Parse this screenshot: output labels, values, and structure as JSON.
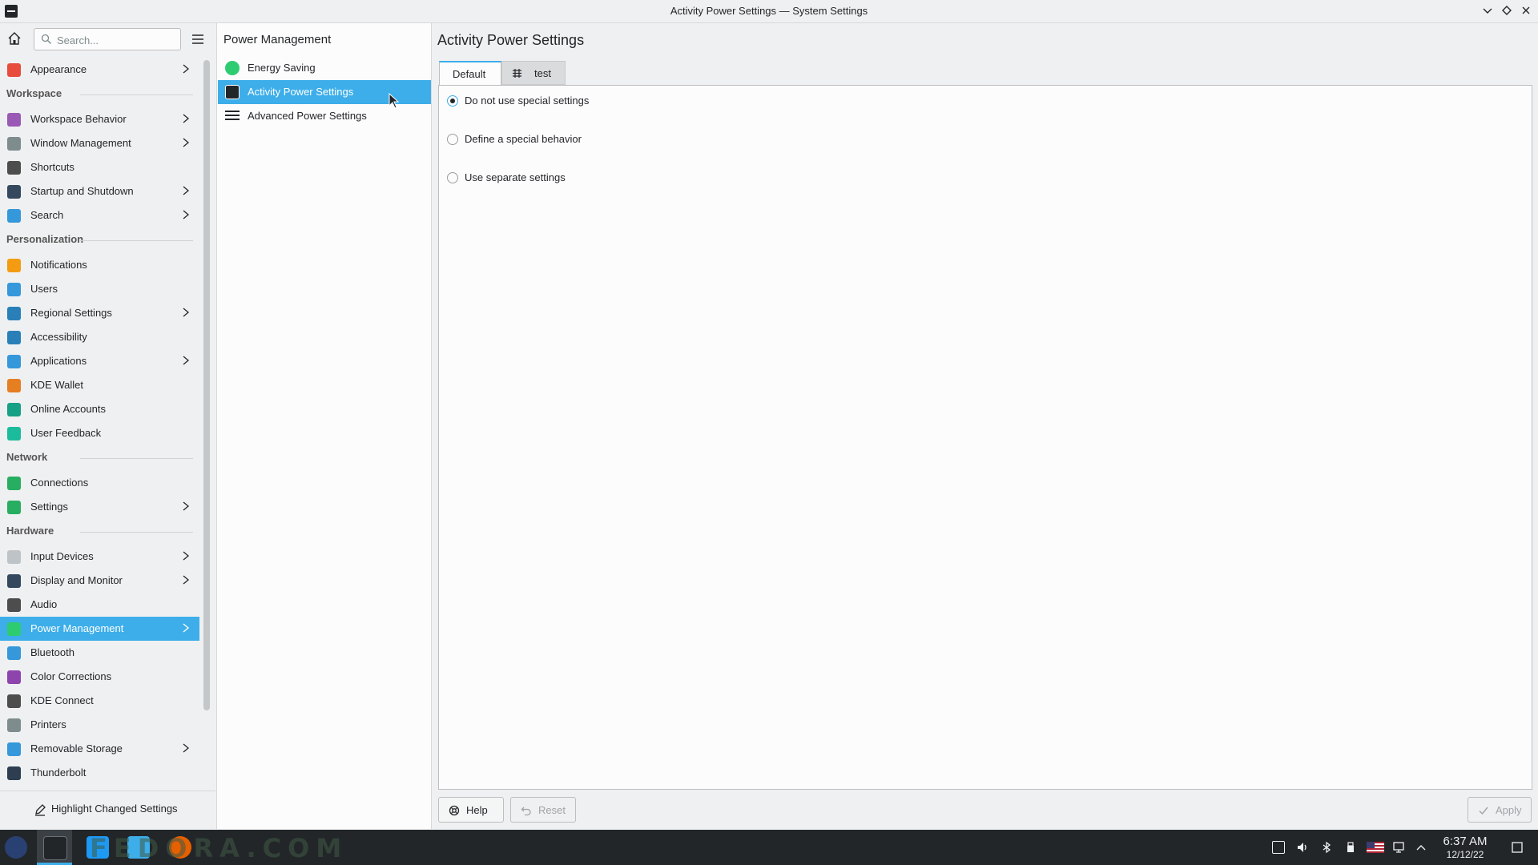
{
  "window": {
    "title": "Activity Power Settings — System Settings",
    "controls": [
      "chevron-down",
      "restore",
      "close"
    ]
  },
  "search": {
    "placeholder": "Search..."
  },
  "sidebar": {
    "sections": [
      "Workspace",
      "Personalization",
      "Network",
      "Hardware"
    ],
    "items": [
      {
        "label": "Appearance",
        "icon": "appearance-icon",
        "chevron": true,
        "color": "#e74c3c"
      },
      {
        "label": "Workspace Behavior",
        "icon": "workspace-behavior-icon",
        "chevron": true,
        "color": "#9b59b6"
      },
      {
        "label": "Window Management",
        "icon": "window-management-icon",
        "chevron": true,
        "color": "#7f8c8d"
      },
      {
        "label": "Shortcuts",
        "icon": "keyboard-icon",
        "chevron": false,
        "color": "#4d4d4d"
      },
      {
        "label": "Startup and Shutdown",
        "icon": "startup-icon",
        "chevron": true,
        "color": "#34495e"
      },
      {
        "label": "Search",
        "icon": "search-icon",
        "chevron": true,
        "color": "#3498db"
      },
      {
        "label": "Notifications",
        "icon": "bell-icon",
        "chevron": false,
        "color": "#f39c12"
      },
      {
        "label": "Users",
        "icon": "users-icon",
        "chevron": false,
        "color": "#3498db"
      },
      {
        "label": "Regional Settings",
        "icon": "regional-icon",
        "chevron": true,
        "color": "#2980b9"
      },
      {
        "label": "Accessibility",
        "icon": "accessibility-icon",
        "chevron": false,
        "color": "#2980b9"
      },
      {
        "label": "Applications",
        "icon": "applications-icon",
        "chevron": true,
        "color": "#3498db"
      },
      {
        "label": "KDE Wallet",
        "icon": "wallet-icon",
        "chevron": false,
        "color": "#e67e22"
      },
      {
        "label": "Online Accounts",
        "icon": "online-accounts-icon",
        "chevron": false,
        "color": "#16a085"
      },
      {
        "label": "User Feedback",
        "icon": "feedback-icon",
        "chevron": false,
        "color": "#1abc9c"
      },
      {
        "label": "Connections",
        "icon": "globe-icon",
        "chevron": false,
        "color": "#27ae60"
      },
      {
        "label": "Settings",
        "icon": "network-settings-icon",
        "chevron": true,
        "color": "#27ae60"
      },
      {
        "label": "Input Devices",
        "icon": "mouse-icon",
        "chevron": true,
        "color": "#bdc3c7"
      },
      {
        "label": "Display and Monitor",
        "icon": "monitor-icon",
        "chevron": true,
        "color": "#34495e"
      },
      {
        "label": "Audio",
        "icon": "speaker-icon",
        "chevron": false,
        "color": "#4d4d4d"
      },
      {
        "label": "Power Management",
        "icon": "power-icon",
        "chevron": true,
        "color": "#2ecc71",
        "active": true
      },
      {
        "label": "Bluetooth",
        "icon": "bluetooth-icon",
        "chevron": false,
        "color": "#3498db"
      },
      {
        "label": "Color Corrections",
        "icon": "color-icon",
        "chevron": false,
        "color": "#8e44ad"
      },
      {
        "label": "KDE Connect",
        "icon": "phone-icon",
        "chevron": false,
        "color": "#4d4d4d"
      },
      {
        "label": "Printers",
        "icon": "printer-icon",
        "chevron": false,
        "color": "#7f8c8d"
      },
      {
        "label": "Removable Storage",
        "icon": "usb-icon",
        "chevron": true,
        "color": "#3498db"
      },
      {
        "label": "Thunderbolt",
        "icon": "thunderbolt-icon",
        "chevron": false,
        "color": "#2c3e50"
      }
    ],
    "highlight_label": "Highlight Changed Settings"
  },
  "subpanel": {
    "header": "Power Management",
    "items": [
      {
        "label": "Energy Saving",
        "icon": "energy-saving-icon",
        "color": "#2ecc71"
      },
      {
        "label": "Activity Power Settings",
        "icon": "activity-icon",
        "color": "#232629",
        "active": true
      },
      {
        "label": "Advanced Power Settings",
        "icon": "hamburger-icon",
        "color": "#232629"
      }
    ]
  },
  "main": {
    "title": "Activity Power Settings",
    "tabs": [
      {
        "label": "Default",
        "selected": true
      },
      {
        "label": "test",
        "selected": false
      }
    ],
    "options": [
      {
        "label": "Do not use special settings",
        "checked": true
      },
      {
        "label": "Define a special behavior",
        "checked": false
      },
      {
        "label": "Use separate settings",
        "checked": false
      }
    ],
    "buttons": {
      "help": "Help",
      "reset": "Reset",
      "apply": "Apply"
    }
  },
  "taskbar": {
    "watermark": "FEDORA.COM",
    "time": "6:37 AM",
    "date": "12/12/22",
    "accent": "#3daee9"
  }
}
